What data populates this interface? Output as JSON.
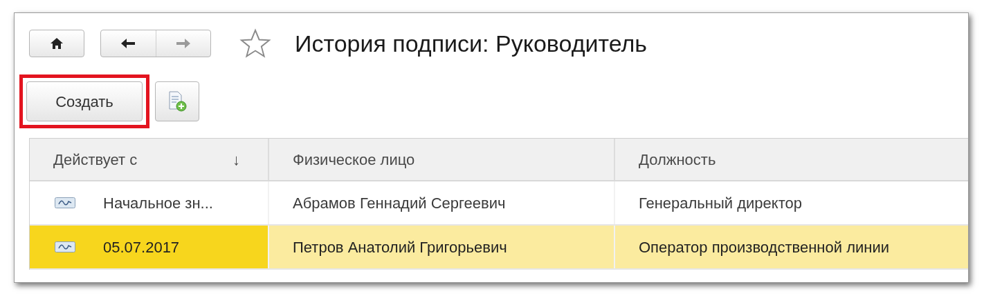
{
  "window": {
    "title": "История подписи: Руководитель",
    "favorite": false
  },
  "toolbar": {
    "create_button": "Создать",
    "create_highlighted": true
  },
  "table": {
    "columns": [
      {
        "label": "Действует с",
        "sort": "↓"
      },
      {
        "label": "Физическое лицо"
      },
      {
        "label": "Должность"
      }
    ],
    "rows": [
      {
        "valid_from": "Начальное зн...",
        "person": "Абрамов Геннадий Сергеевич",
        "position": "Генеральный директор",
        "selected": false
      },
      {
        "valid_from": "05.07.2017",
        "person": "Петров Анатолий Григорьевич",
        "position": "Оператор производственной линии",
        "selected": true
      }
    ]
  }
}
